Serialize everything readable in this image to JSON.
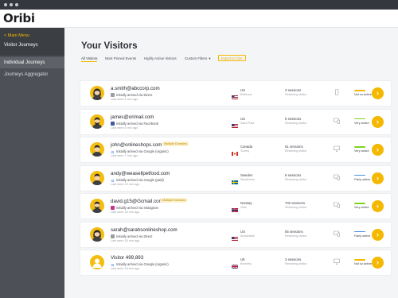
{
  "app": {
    "brand": "Oribi"
  },
  "sidebar": {
    "main_menu": "< Main Menu",
    "section_title": "Visitor Journeys",
    "items": [
      {
        "label": "Individual Journeys",
        "active": true
      },
      {
        "label": "Journeys Aggregator",
        "active": false
      }
    ]
  },
  "main": {
    "title": "Your Visitors",
    "filters": [
      {
        "label": "All Visitors",
        "active": true
      },
      {
        "label": "Most Pinned Events",
        "active": false
      },
      {
        "label": "Highly Active Visitors",
        "active": false
      },
      {
        "label": "Custom Filters",
        "active": false,
        "has_dropdown": true
      }
    ],
    "export_label": "Export to CSV"
  },
  "rows": [
    {
      "name": "a.smith@abccorp.com",
      "badge": "",
      "arrival": "Initially arrived via Direct",
      "source_icon": "direct-icon",
      "last_seen": "Last seen 6 min ago",
      "country": "US",
      "city": "Bellevue",
      "country_flag": "flag-us-icon",
      "sessions": "3 sessions",
      "visitor_type": "Returning visitor",
      "device": "mobile-icon",
      "activity": "Not so active",
      "activity_color": "#f5b800",
      "avatar_style": "female"
    },
    {
      "name": "james@orimail.com",
      "badge": "",
      "arrival": "Initially arrived via Facebook",
      "source_icon": "facebook-icon",
      "last_seen": "Last seen 6 min ago",
      "country": "US",
      "city": "Saint Paul",
      "country_flag": "flag-us-icon",
      "sessions": "6 sessions",
      "visitor_type": "Returning visitor",
      "device": "desktop-mobile-icon",
      "activity": "Very active",
      "activity_color": "#7ed321",
      "avatar_style": "bearded"
    },
    {
      "name": "john@onlineshops.com",
      "badge": "Multiple Domains",
      "arrival": "Initially arrived via Google (organic)",
      "source_icon": "google-icon",
      "last_seen": "Last seen 7 min ago",
      "country": "Canada",
      "city": "Surrey",
      "country_flag": "flag-ca-icon",
      "sessions": "61 sessions",
      "visitor_type": "Returning visitor",
      "device": "desktop-icon",
      "activity": "Very active",
      "activity_color": "#7ed321",
      "avatar_style": "male"
    },
    {
      "name": "andy@weasellpetfood.com",
      "badge": "",
      "arrival": "Initially arrived via Google (paid)",
      "source_icon": "google-icon",
      "last_seen": "Last seen 13 min ago",
      "country": "Sweden",
      "city": "Stockholm",
      "country_flag": "flag-se-icon",
      "sessions": "6 sessions",
      "visitor_type": "Returning visitor",
      "device": "desktop-mobile-icon",
      "activity": "Fairly active",
      "activity_color": "#4a90e2",
      "avatar_style": "male"
    },
    {
      "name": "david.g15@Gcmail.com",
      "badge": "Multiple Domains",
      "arrival": "Initially arrived via Instagram",
      "source_icon": "instagram-icon",
      "last_seen": "Last seen 15 min ago",
      "country": "Norway",
      "city": "Oslo",
      "country_flag": "flag-no-icon",
      "sessions": "702 sessions",
      "visitor_type": "Returning visitor",
      "device": "desktop-mobile-icon",
      "activity": "Very active",
      "activity_color": "#7ed321",
      "avatar_style": "bearded"
    },
    {
      "name": "sarah@sarahsonlineshop.com",
      "badge": "",
      "arrival": "Initially arrived via Direct",
      "source_icon": "direct-icon",
      "last_seen": "Last seen 15 min ago",
      "country": "US",
      "city": "Annandale",
      "country_flag": "flag-us-icon",
      "sessions": "55 sessions",
      "visitor_type": "Returning visitor",
      "device": "desktop-mobile-icon",
      "activity": "Fairly active",
      "activity_color": "#4a90e2",
      "avatar_style": "female"
    },
    {
      "name": "Visitor 499,893",
      "badge": "",
      "arrival": "Initially arrived via Google (organic)",
      "source_icon": "google-icon",
      "last_seen": "Last seen 16 min ago",
      "country": "UK",
      "city": "Bromley",
      "country_flag": "flag-uk-icon",
      "sessions": "3 sessions",
      "visitor_type": "Returning visitor",
      "device": "desktop-icon",
      "activity": "Not so active",
      "activity_color": "#f5b800",
      "avatar_style": "anonymous"
    }
  ]
}
